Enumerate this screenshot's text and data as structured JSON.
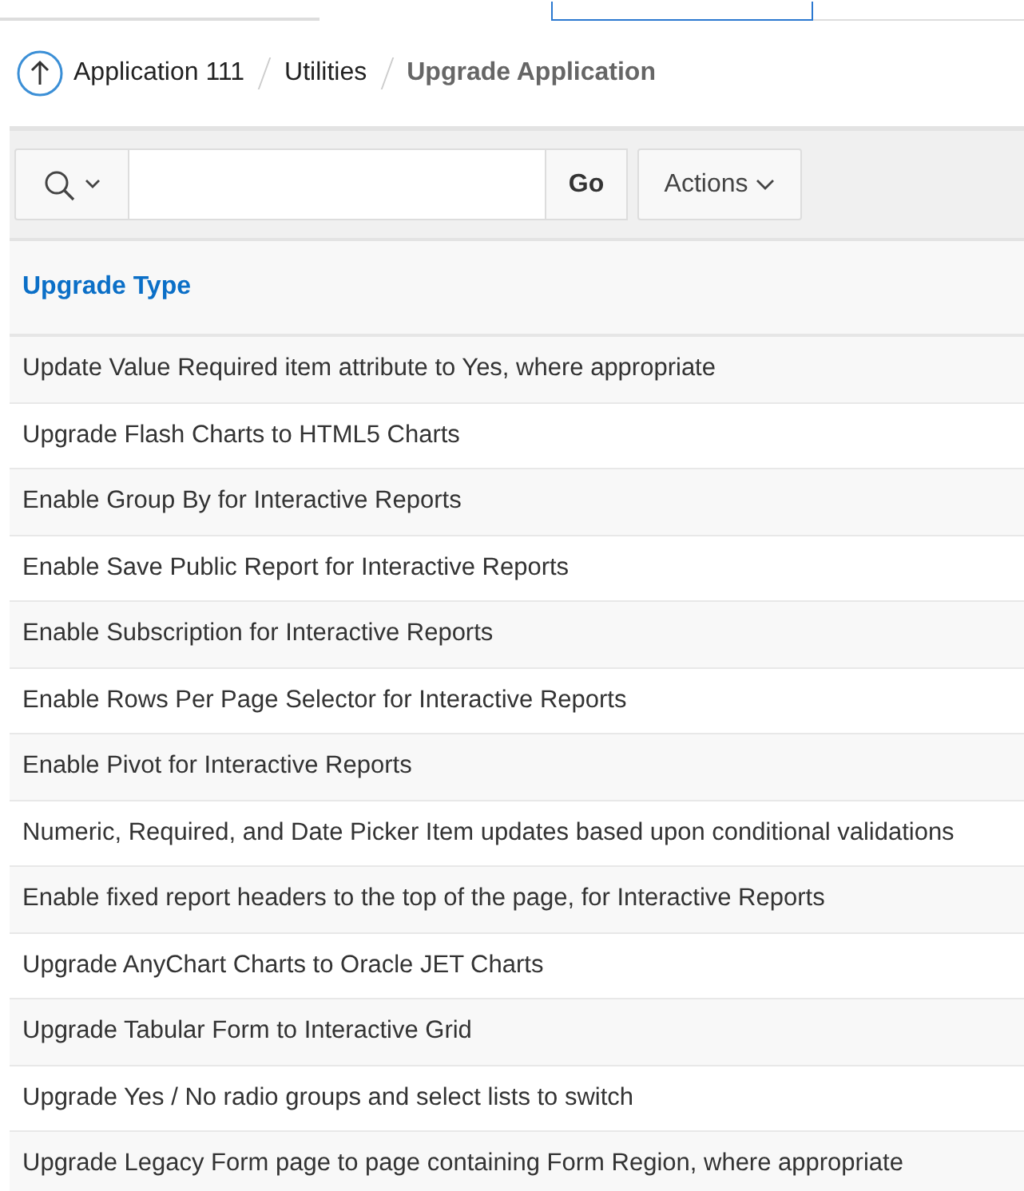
{
  "breadcrumb": [
    {
      "label": "Application 111",
      "current": false
    },
    {
      "label": "Utilities",
      "current": false
    },
    {
      "label": "Upgrade Application",
      "current": true
    }
  ],
  "toolbar": {
    "go_button": "Go",
    "actions_button": "Actions"
  },
  "table": {
    "columns": [
      "Upgrade Type"
    ],
    "rows": [
      "Update Value Required item attribute to Yes, where appropriate",
      "Upgrade Flash Charts to HTML5 Charts",
      "Enable Group By for Interactive Reports",
      "Enable Save Public Report for Interactive Reports",
      "Enable Subscription for Interactive Reports",
      "Enable Rows Per Page Selector for Interactive Reports",
      "Enable Pivot for Interactive Reports",
      "Numeric, Required, and Date Picker Item updates based upon conditional validations",
      "Enable fixed report headers to the top of the page, for Interactive Reports",
      "Upgrade AnyChart Charts to Oracle JET Charts",
      "Upgrade Tabular Form to Interactive Grid",
      "Upgrade Yes / No radio groups and select lists to switch",
      "Upgrade Legacy Form page to page containing Form Region, where appropriate"
    ]
  }
}
